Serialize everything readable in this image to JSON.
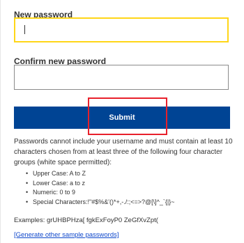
{
  "form": {
    "new_password": {
      "label": "New password",
      "value": ""
    },
    "confirm_password": {
      "label": "Confirm new password",
      "value": ""
    },
    "submit_label": "Submit"
  },
  "rules": {
    "intro": "Passwords cannot include your username and must contain at least 10 characters chosen from at least three of the following four character groups (white space permitted):",
    "groups": [
      "Upper Case: A to Z",
      "Lower Case: a to z",
      "Numeric: 0 to 9",
      "Special Characters:!\"#$%&'()*+,-./:;<=>?@[\\]^_`{|}~"
    ],
    "examples": "Examples: grUHBPHza[ fgkExFoyP0 ZeGfXvZpt(",
    "generate_link": "[Generate other sample passwords]"
  },
  "colors": {
    "submit_background": "#004494",
    "focus_border": "#ffd617",
    "highlight": "#e8202b",
    "link": "#0e47cb"
  }
}
